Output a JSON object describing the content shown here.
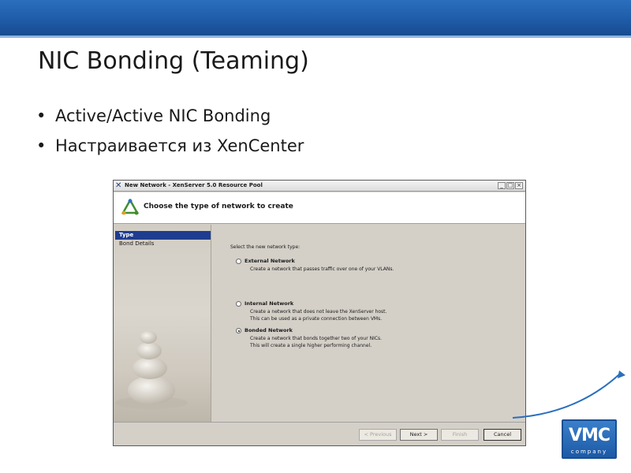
{
  "slide": {
    "title": "NIC Bonding (Teaming)",
    "bullets": [
      "Active/Active NIC Bonding",
      "Настраивается из XenCenter"
    ],
    "bullet_glyph": "•"
  },
  "dialog": {
    "title": "New Network - XenServer 5.0 Resource Pool",
    "window_buttons": [
      "_",
      "□",
      "×"
    ],
    "header": "Choose the type of network to create",
    "sidebar": [
      {
        "label": "Type",
        "active": true
      },
      {
        "label": "Bond Details",
        "active": false
      }
    ],
    "prompt": "Select the new network type:",
    "options": [
      {
        "label": "External Network",
        "selected": false,
        "description": [
          "Create a network that passes traffic over one of your VLANs."
        ]
      },
      {
        "label": "Internal Network",
        "selected": false,
        "description": [
          "Create a network that does not leave the XenServer host.",
          "This can be used as a private connection between VMs."
        ]
      },
      {
        "label": "Bonded Network",
        "selected": true,
        "description": [
          "Create a network that bonds together two of your NICs.",
          "This will create a single higher performing channel."
        ]
      }
    ],
    "buttons": {
      "previous": "< Previous",
      "next": "Next >",
      "finish": "Finish",
      "cancel": "Cancel"
    }
  },
  "logo": {
    "text": "VMC",
    "subtext": "company"
  },
  "colors": {
    "top_bar": "#1f5ca8",
    "sidebar_active": "#1f3d8f",
    "logo_blue": "#2a6fbd"
  },
  "icons": {
    "dialog_header_icon": "network-wizard-icon",
    "app_icon": "xencenter-icon"
  }
}
